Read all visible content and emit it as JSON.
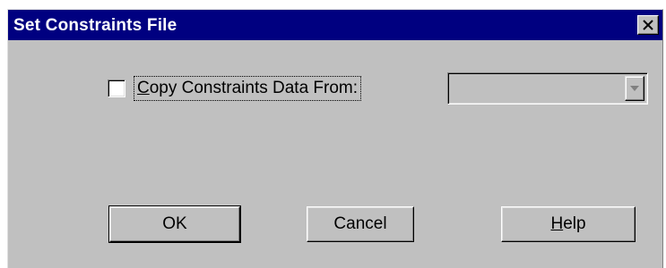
{
  "window": {
    "title": "Set Constraints File",
    "close_icon": "close-icon"
  },
  "copy_option": {
    "checked": false,
    "label_prefix": "C",
    "label_rest": "opy Constraints Data From:"
  },
  "source_select": {
    "value": "",
    "enabled": false,
    "arrow_icon": "chevron-down-icon"
  },
  "buttons": {
    "ok": "OK",
    "cancel": "Cancel",
    "help_prefix": "H",
    "help_rest": "elp"
  },
  "colors": {
    "title_bar": "#000080",
    "face": "#c0c0c0",
    "title_text": "#ffffff"
  }
}
